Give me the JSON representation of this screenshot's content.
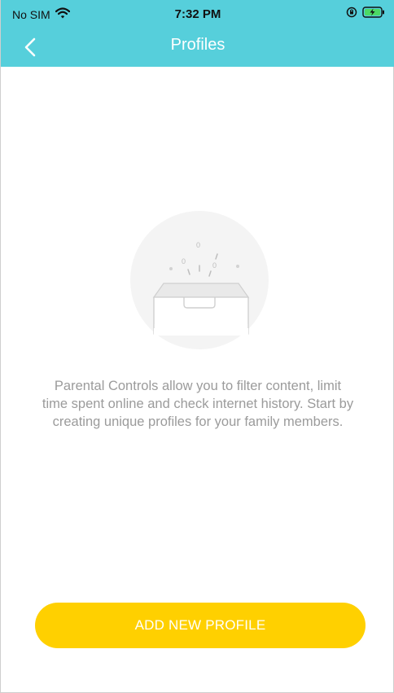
{
  "status_bar": {
    "carrier": "No SIM",
    "time": "7:32 PM",
    "icons": [
      "wifi-icon",
      "orientation-lock-icon",
      "battery-charging-icon"
    ]
  },
  "nav": {
    "title": "Profiles",
    "back_icon": "chevron-left-icon"
  },
  "empty_state": {
    "illustration": "empty-drawer-icon",
    "description": "Parental Controls allow you to filter content, limit time spent online and check internet history. Start by creating unique profiles for your family members."
  },
  "actions": {
    "add_profile_label": "ADD NEW PROFILE"
  },
  "colors": {
    "header": "#56cfdb",
    "button": "#ffd000",
    "text_muted": "#9b9b9b"
  }
}
